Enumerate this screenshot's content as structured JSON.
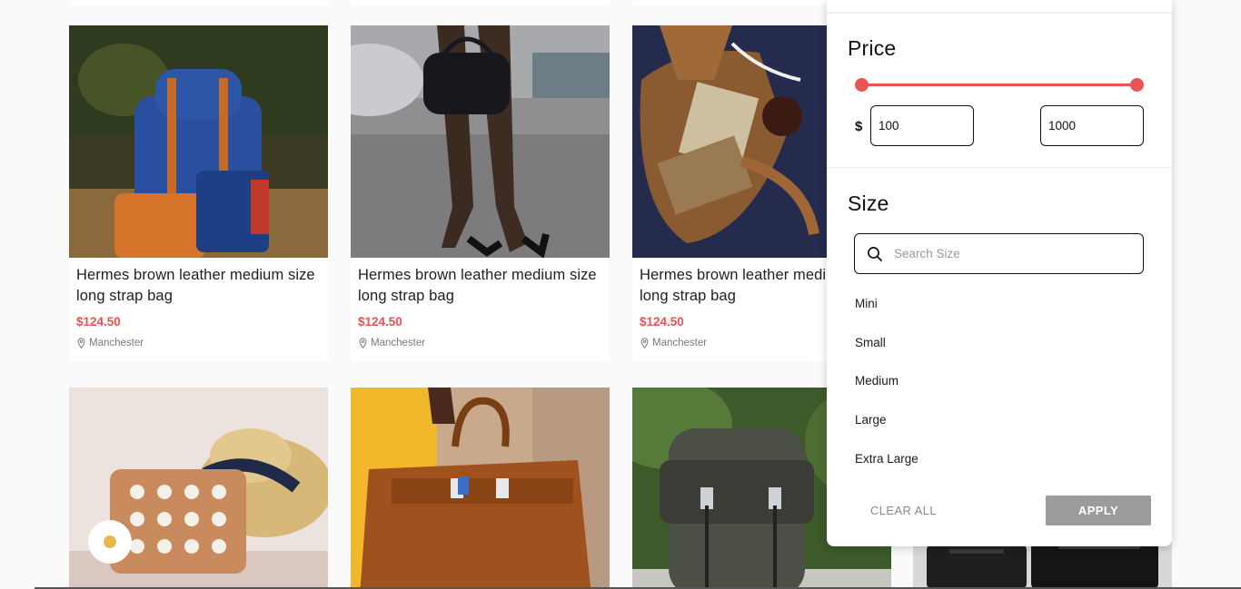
{
  "products": [
    {
      "title": "Hermes brown leather medium size long strap bag",
      "price": "$124.50",
      "location": "Manchester"
    },
    {
      "title": "Hermes brown leather medium size long strap bag",
      "price": "$124.50",
      "location": "Manchester"
    },
    {
      "title": "Hermes brown leather medi",
      "title_line2": "long strap bag",
      "price": "$124.50",
      "location": "Manchester"
    }
  ],
  "filter": {
    "price": {
      "heading": "Price",
      "currency": "$",
      "min": "100",
      "max": "1000"
    },
    "size": {
      "heading": "Size",
      "search_placeholder": "Search Size",
      "options": [
        "Mini",
        "Small",
        "Medium",
        "Large",
        "Extra Large"
      ]
    },
    "clear_label": "CLEAR ALL",
    "apply_label": "APPLY"
  },
  "colors": {
    "accent": "#ec5454",
    "price": "#ec4f4f",
    "apply_disabled": "#9b9b9b"
  }
}
